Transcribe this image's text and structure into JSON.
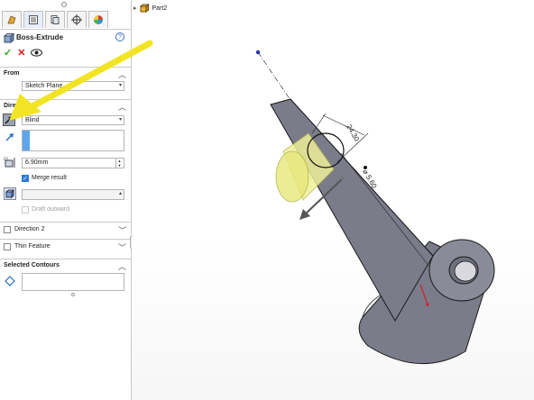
{
  "tree": {
    "expander": "▸",
    "root_label": "Part2"
  },
  "feature": {
    "title": "Boss-Extrude",
    "help": "?",
    "ok_symbol": "✓",
    "cancel_symbol": "✕"
  },
  "from": {
    "header": "From",
    "value": "Sketch Plane"
  },
  "direction1": {
    "header": "Direction 1",
    "end_condition": "Blind",
    "depth": "6.90mm",
    "merge_result_label": "Merge result",
    "merge_result_checked": true,
    "draft_outward_label": "Draft outward",
    "draft_outward_checked": false
  },
  "direction2": {
    "header": "Direction 2"
  },
  "thin_feature": {
    "header": "Thin Feature"
  },
  "selected_contours": {
    "header": "Selected Contours"
  },
  "annotations": {
    "dim_top": "24.30",
    "dim_diameter": "⌀ 5.60"
  },
  "colors": {
    "accent_arrow": "#f2e424",
    "selection_blue": "#2a7bd6",
    "preview_yellow": "#e8e87a",
    "part_body": "#7b7c8a",
    "part_edge": "#1a1a1a"
  },
  "icons": [
    "feature-manager-icon",
    "property-manager-icon",
    "configuration-manager-icon",
    "dimxpert-icon",
    "display-manager-icon",
    "boss-extrude-icon",
    "help-icon",
    "preview-eye-icon",
    "reverse-direction-icon",
    "direction-arrow-icon",
    "depth-icon",
    "body-selection-icon",
    "contour-icon",
    "part-icon"
  ]
}
